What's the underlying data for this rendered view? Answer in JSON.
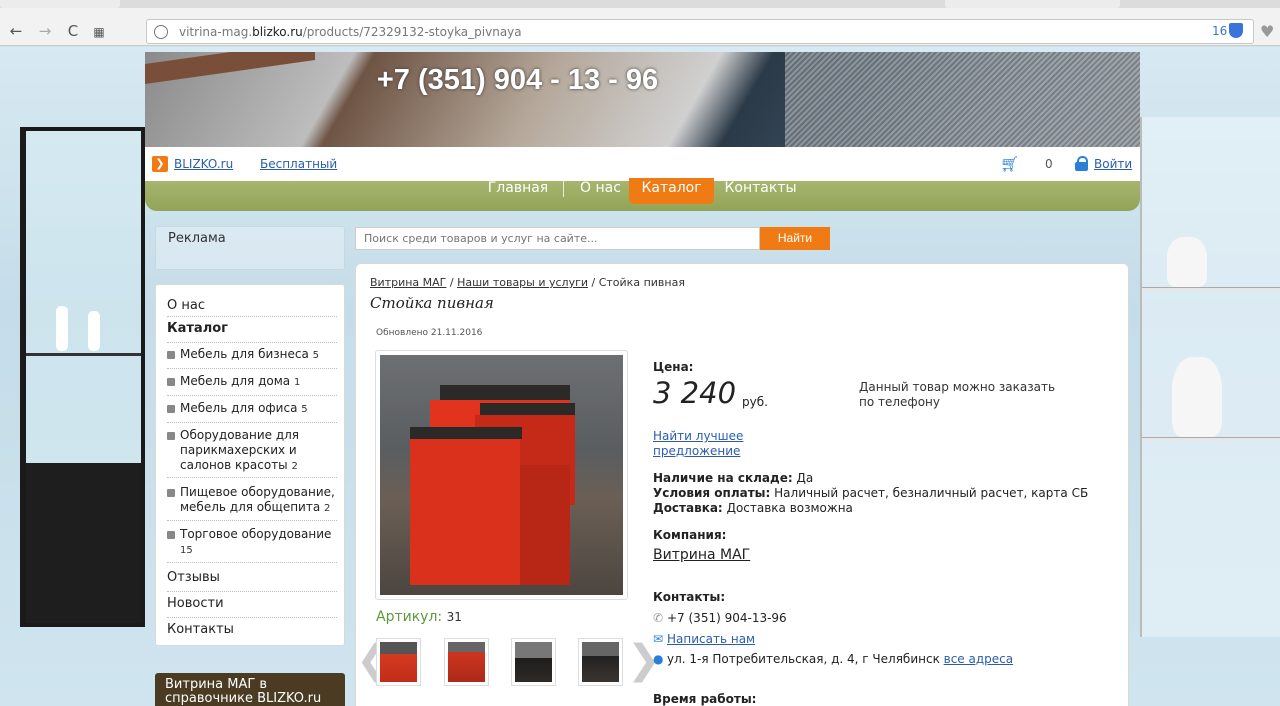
{
  "browser": {
    "url_prefix": "vitrina-mag.",
    "url_domain": "blizko.ru",
    "url_path": "/products/72329132-stoyka_pivnaya",
    "tracker_count": "16",
    "icons": [
      "back-icon",
      "forward-icon",
      "reload-icon",
      "apps-icon",
      "site-info-icon",
      "shield-icon",
      "heart-icon"
    ]
  },
  "header": {
    "phone": "+7 (351) 904 - 13 - 96",
    "brand_link": "BLIZKO.ru",
    "free_link": "Бесплатный",
    "cart_count": "0",
    "login": "Войти"
  },
  "nav": {
    "items": [
      "Главная",
      "О нас",
      "Каталог",
      "Контакты"
    ],
    "active": "Каталог"
  },
  "sidebar": {
    "ad": "Реклама",
    "items": [
      {
        "label": "О нас"
      },
      {
        "label": "Каталог"
      },
      {
        "label": "Мебель для бизнеса",
        "count": "5"
      },
      {
        "label": "Мебель для дома",
        "count": "1"
      },
      {
        "label": "Мебель для офиса",
        "count": "5"
      },
      {
        "label": "Оборудование для парикмахерских и салонов красоты",
        "count": "2"
      },
      {
        "label": "Пищевое оборудование, мебель для общепита",
        "count": "2"
      },
      {
        "label": "Торговое оборудование",
        "count": "15"
      },
      {
        "label": "Отзывы"
      },
      {
        "label": "Новости"
      },
      {
        "label": "Контакты"
      }
    ],
    "directory": "Витрина МАГ в справочнике BLIZKO.ru"
  },
  "search": {
    "placeholder": "Поиск среди товаров и услуг на сайте...",
    "button": "Найти"
  },
  "product": {
    "breadcrumb": [
      "Витрина МАГ",
      "Наши товары и услуги",
      "Стойка пивная"
    ],
    "breadcrumb_sep": " / ",
    "title": "Стойка пивная",
    "updated": "Обновлено 21.11.2016",
    "articul_label": "Артикул:",
    "articul": "31",
    "price_label": "Цена:",
    "price": "3 240",
    "currency": "руб.",
    "order_note": "Данный товар можно заказать по телефону",
    "best_offer": "Найти лучшее предложение",
    "stock_label": "Наличие на складе:",
    "stock": "Да",
    "payment_label": "Условия оплаты:",
    "payment": "Наличный расчет, безналичный расчет, карта СБ",
    "delivery_label": "Доставка:",
    "delivery": "Доставка возможна",
    "company_label": "Компания:",
    "company": "Витрина МАГ",
    "contacts_label": "Контакты:",
    "phone": "+7 (351) 904-13-96",
    "write_us": "Написать нам",
    "address": "ул. 1-я Потребительская, д. 4, г Челябинск",
    "all_addresses": "все адреса",
    "hours_label": "Время работы:"
  },
  "colors": {
    "accent": "#f07b14",
    "nav_green": "#9aab60",
    "link_blue": "#2a5db0",
    "articul_green": "#5b9b3b"
  }
}
